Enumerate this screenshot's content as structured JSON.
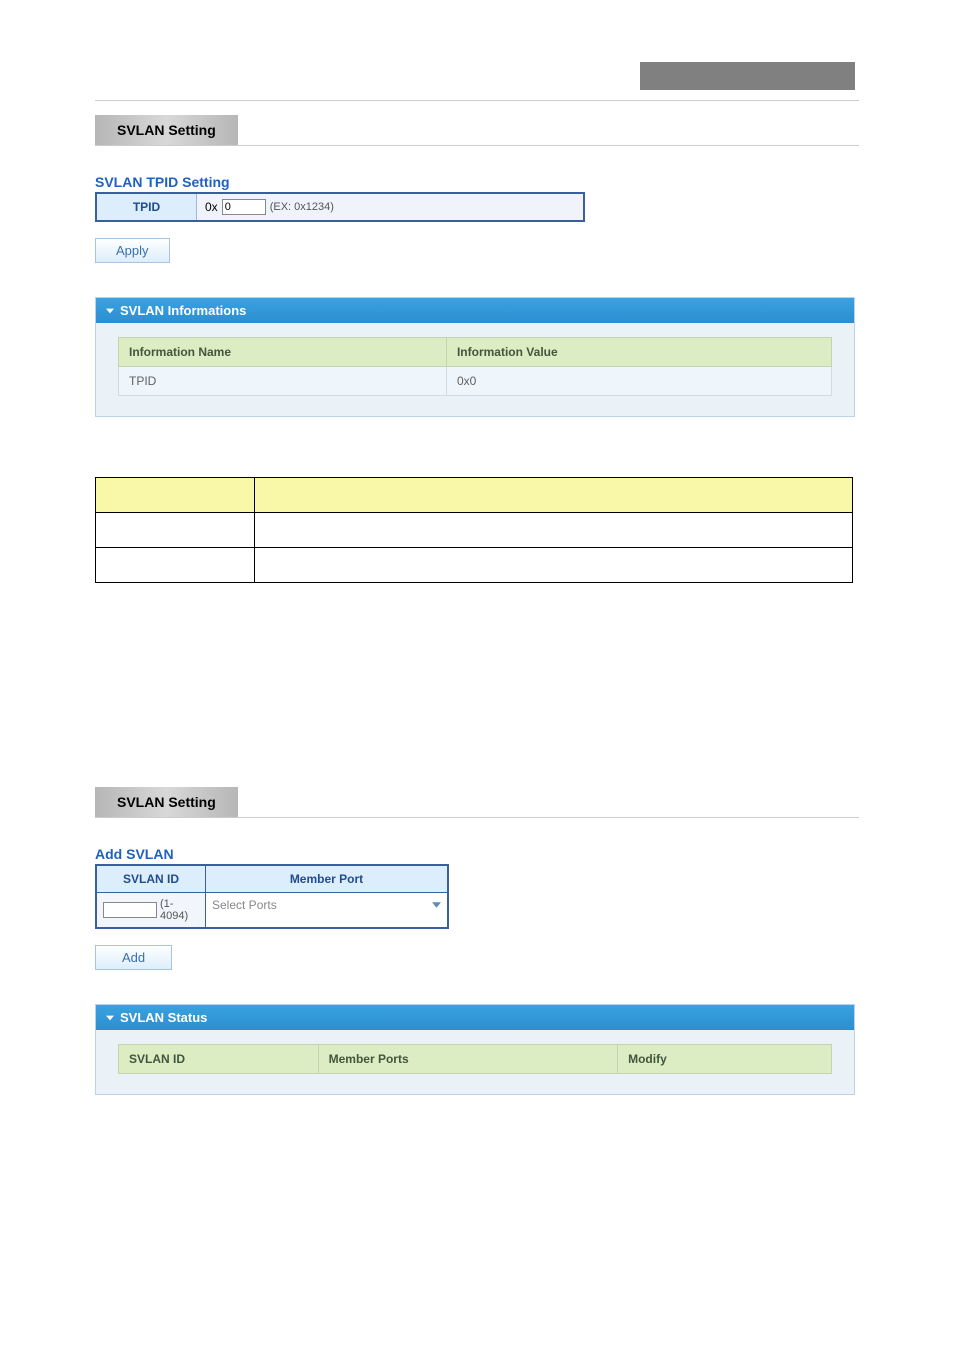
{
  "section1": {
    "title": "SVLAN Setting"
  },
  "tpid_box": {
    "heading": "SVLAN TPID Setting",
    "label": "TPID",
    "prefix": "0x",
    "value": "0",
    "hint": "(EX: 0x1234)"
  },
  "apply_button": "Apply",
  "info_panel": {
    "title": "SVLAN Informations",
    "col_name": "Information Name",
    "col_value": "Information Value",
    "rows": [
      {
        "name": "TPID",
        "value": "0x0"
      }
    ]
  },
  "section2": {
    "title": "SVLAN Setting"
  },
  "add_svlan": {
    "heading": "Add SVLAN",
    "col_id": "SVLAN ID",
    "col_port": "Member Port",
    "range": "(1-4094)",
    "dropdown_placeholder": "Select Ports"
  },
  "add_button": "Add",
  "status_panel": {
    "title": "SVLAN Status",
    "col_id": "SVLAN ID",
    "col_ports": "Member Ports",
    "col_modify": "Modify"
  }
}
